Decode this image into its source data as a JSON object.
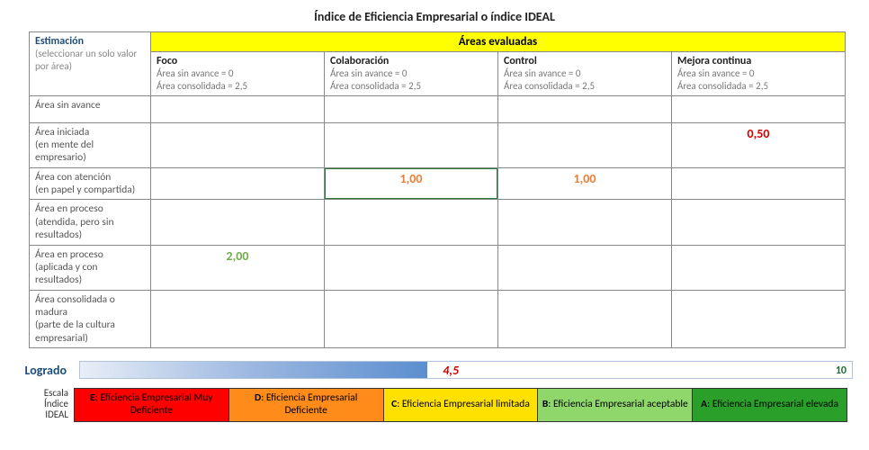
{
  "title": "Índice de Eficiencia Empresarial o índice IDEAL",
  "table": {
    "areas_header": "Áreas evaluadas",
    "estimation_label": "Estimación",
    "estimation_sub": "(seleccionar un solo valor por área)",
    "columns": [
      "Foco",
      "Colaboración",
      "Control",
      "Mejora continua"
    ],
    "col_sub_line1": "Área sin avance = 0",
    "col_sub_line2": "Área consolidada = 2,5",
    "rows": [
      {
        "label": "Área sin avance",
        "sub": "",
        "values": [
          "",
          "",
          "",
          ""
        ]
      },
      {
        "label": "Área iniciada",
        "sub": "(en mente del empresario)",
        "values": [
          "",
          "",
          "",
          "0,50"
        ]
      },
      {
        "label": "Área con atención",
        "sub": "(en papel y compartida)",
        "values": [
          "",
          "1,00",
          "1,00",
          ""
        ]
      },
      {
        "label": "Área en proceso",
        "sub": "(atendida, pero sin resultados)",
        "values": [
          "",
          "",
          "",
          ""
        ]
      },
      {
        "label": "Área en proceso",
        "sub": "(aplicada y con resultados)",
        "values": [
          "2,00",
          "",
          "",
          ""
        ]
      },
      {
        "label": "Área consolidada o madura",
        "sub": "(parte de la cultura empresarial)",
        "values": [
          "",
          "",
          "",
          ""
        ]
      }
    ],
    "value_colors": {
      "0,50": "val-red",
      "1,00": "val-orange",
      "2,00": "val-green"
    },
    "selected_cell": {
      "row": 2,
      "col": 1
    }
  },
  "logrado": {
    "label": "Logrado",
    "value": "4,5",
    "max": "10",
    "percent": 45
  },
  "scale": {
    "label_line1": "Escala",
    "label_line2": "Índice",
    "label_line3": "IDEAL",
    "bands": [
      {
        "letter": "E",
        "text": ": Eficiencia Empresarial Muy Deficiente",
        "class": "band-e"
      },
      {
        "letter": "D",
        "text": ": Eficiencia Empresarial Deficiente",
        "class": "band-d"
      },
      {
        "letter": "C",
        "text": ": Eficiencia Empresarial limitada",
        "class": "band-c"
      },
      {
        "letter": "B",
        "text": ": Eficiencia Empresarial aceptable",
        "class": "band-b"
      },
      {
        "letter": "A",
        "text": ": Eficiencia Empresarial elevada",
        "class": "band-a"
      }
    ]
  },
  "chart_data": {
    "type": "bar",
    "title": "Logrado",
    "categories": [
      "Logrado"
    ],
    "values": [
      4.5
    ],
    "xlabel": "",
    "ylabel": "",
    "ylim": [
      0,
      10
    ],
    "scale_bands": [
      {
        "grade": "E",
        "label": "Eficiencia Empresarial Muy Deficiente",
        "range": [
          0,
          2
        ]
      },
      {
        "grade": "D",
        "label": "Eficiencia Empresarial Deficiente",
        "range": [
          2,
          4
        ]
      },
      {
        "grade": "C",
        "label": "Eficiencia Empresarial limitada",
        "range": [
          4,
          6
        ]
      },
      {
        "grade": "B",
        "label": "Eficiencia Empresarial aceptable",
        "range": [
          6,
          8
        ]
      },
      {
        "grade": "A",
        "label": "Eficiencia Empresarial elevada",
        "range": [
          8,
          10
        ]
      }
    ],
    "matrix": {
      "columns": [
        "Foco",
        "Colaboración",
        "Control",
        "Mejora continua"
      ],
      "rows": [
        "Área sin avance",
        "Área iniciada",
        "Área con atención",
        "Área en proceso (sin resultados)",
        "Área en proceso (con resultados)",
        "Área consolidada o madura"
      ],
      "values": {
        "Foco": 2.0,
        "Colaboración": 1.0,
        "Control": 1.0,
        "Mejora continua": 0.5
      },
      "cell_range": [
        0,
        2.5
      ]
    }
  }
}
